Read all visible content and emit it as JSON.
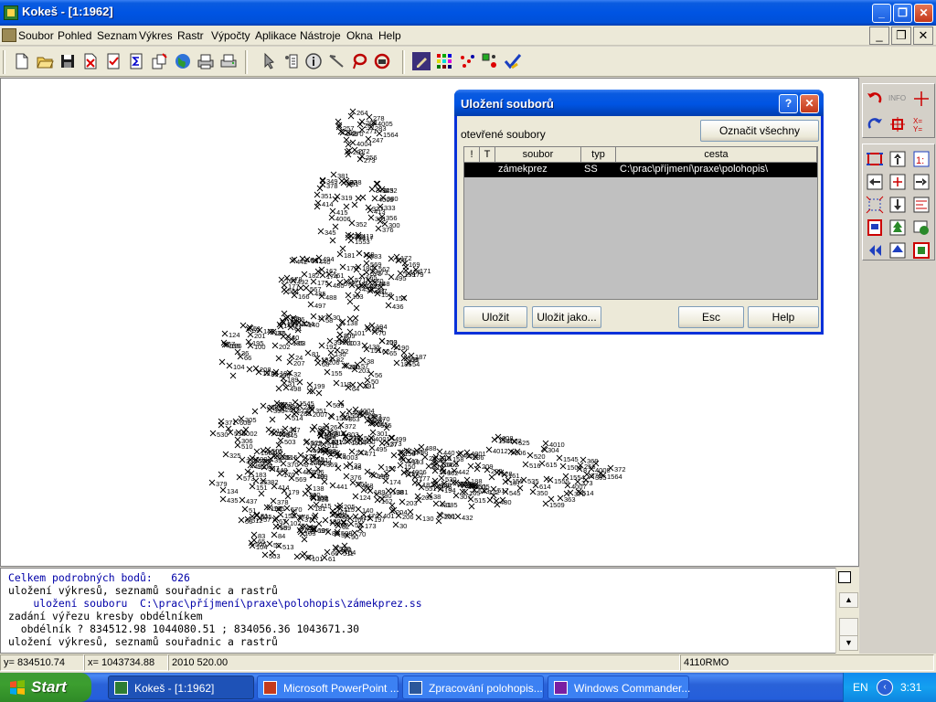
{
  "window": {
    "title": "Kokeš - [1:1962]"
  },
  "menubar": {
    "items": [
      "Soubor",
      "Pohled",
      "Seznam",
      "Výkres",
      "Rastr",
      "Výpočty",
      "Aplikace",
      "Nástroje",
      "Okna",
      "Help"
    ]
  },
  "toolbar": {
    "icons": [
      "new-file-icon",
      "open-folder-icon",
      "save-icon",
      "export-icon",
      "checklist-icon",
      "sum-icon",
      "copy-icon",
      "globe-icon",
      "print-preview-icon",
      "print-icon",
      "pointer-icon",
      "list-icon",
      "info-icon",
      "measure-icon",
      "lasso-icon",
      "undo-circle-icon",
      "pencil-icon",
      "grid-colors-icon",
      "points-icon",
      "select-points-icon",
      "checkmark-icon"
    ]
  },
  "canvas": {
    "labels": [
      "1564",
      "256",
      "257",
      "263",
      "264",
      "267",
      "4005",
      "4004",
      "247",
      "249",
      "271",
      "270",
      "272",
      "281",
      "273",
      "278",
      "280",
      "283",
      "290",
      "301",
      "300",
      "319",
      "325",
      "327",
      "333",
      "338",
      "1553",
      "345",
      "349",
      "351",
      "352",
      "356",
      "382",
      "376",
      "381",
      "380",
      "4006",
      "379",
      "378",
      "401",
      "412",
      "4009",
      "415",
      "414",
      "413",
      "417",
      "431",
      "432",
      "448",
      "443",
      "442",
      "441",
      "435",
      "436",
      "437",
      "438",
      "440",
      "470",
      "471",
      "480",
      "483",
      "488",
      "492",
      "494",
      "495",
      "497",
      "551",
      "561",
      "562",
      "567",
      "569",
      "570",
      "571",
      "572",
      "573",
      "156",
      "157",
      "158",
      "159",
      "160",
      "161",
      "162",
      "163",
      "164",
      "165",
      "166",
      "167",
      "168",
      "169",
      "170",
      "171",
      "172",
      "173",
      "174",
      "175",
      "176",
      "177",
      "178",
      "179",
      "180",
      "181",
      "182",
      "183",
      "184",
      "185",
      "186",
      "187",
      "188",
      "189",
      "190",
      "191",
      "192",
      "193",
      "194",
      "195",
      "196",
      "197",
      "198",
      "199",
      "200",
      "201",
      "202",
      "203",
      "204",
      "205",
      "206",
      "207",
      "208",
      "209",
      "210",
      "118",
      "117",
      "115",
      "124",
      "130",
      "134",
      "135",
      "138",
      "139",
      "140",
      "143",
      "144",
      "148",
      "150",
      "151",
      "153",
      "155",
      "24",
      "30",
      "31",
      "32",
      "35",
      "36",
      "37",
      "38",
      "39",
      "40",
      "50",
      "51",
      "52",
      "54",
      "55",
      "56",
      "57",
      "58",
      "59",
      "60",
      "61",
      "62",
      "63",
      "64",
      "65",
      "66",
      "67",
      "68",
      "69",
      "70",
      "80",
      "81",
      "82",
      "83",
      "84",
      "86",
      "90",
      "100",
      "101",
      "102",
      "103",
      "104",
      "105",
      "498",
      "499",
      "500",
      "503",
      "505",
      "506",
      "509",
      "510",
      "511",
      "512",
      "513",
      "514",
      "515",
      "516",
      "517",
      "520",
      "525",
      "528",
      "529",
      "530",
      "535",
      "543",
      "545",
      "1501",
      "1505",
      "1509",
      "1545",
      "2007",
      "4001",
      "4002",
      "4003",
      "4007",
      "4008",
      "4010",
      "4012",
      "608",
      "614",
      "615",
      "307",
      "306",
      "305",
      "304",
      "303",
      "302",
      "350",
      "363",
      "369",
      "370",
      "371",
      "372",
      "373",
      "8",
      "1504",
      "1554",
      "1555"
    ],
    "mark_color": "#000000"
  },
  "dialog": {
    "title": "Uložení souborů",
    "section_label": "otevřené soubory",
    "select_all_button": "Označit všechny",
    "columns": [
      "!",
      "T",
      "soubor",
      "typ",
      "cesta"
    ],
    "rows": [
      {
        "flag": "",
        "t": "",
        "soubor": "zámekprez",
        "typ": "SS",
        "cesta": "C:\\prac\\příjmení\\praxe\\polohopis\\"
      }
    ],
    "buttons": {
      "save": "Uložit",
      "save_as": "Uložit jako...",
      "esc": "Esc",
      "help": "Help"
    },
    "help_glyph": "?"
  },
  "console": {
    "lines": [
      "Celkem podrobných bodů:   626",
      "uložení výkresů, seznamů souřadnic a rastrů",
      "    uložení souboru  C:\\prac\\příjmení\\praxe\\polohopis\\zámekprez.ss",
      "zadání výřezu kresby obdélníkem",
      "  obdélník ? 834512.98 1044080.51 ; 834056.36 1043671.30",
      "uložení výkresů, seznamů souřadnic a rastrů"
    ]
  },
  "statusbar": {
    "y": "y=  834510.74",
    "x": "x= 1043734.88",
    "extra": "2010 520.00",
    "code": "4110RMO"
  },
  "palette": {
    "info_label": "INFO"
  },
  "taskbar": {
    "start_label": "Start",
    "tasks": [
      "Kokeš - [1:1962]",
      "Microsoft PowerPoint ...",
      "Zpracování polohopis...",
      "Windows Commander..."
    ],
    "language": "EN",
    "clock": "3:31"
  },
  "colors": {
    "titlebar": "#0054e3",
    "dialog_border": "#0831d9",
    "selection_row": "#000000",
    "console_highlight": "#0000a8",
    "palette_red": "#cc0000",
    "palette_blue": "#1e3fbf"
  }
}
